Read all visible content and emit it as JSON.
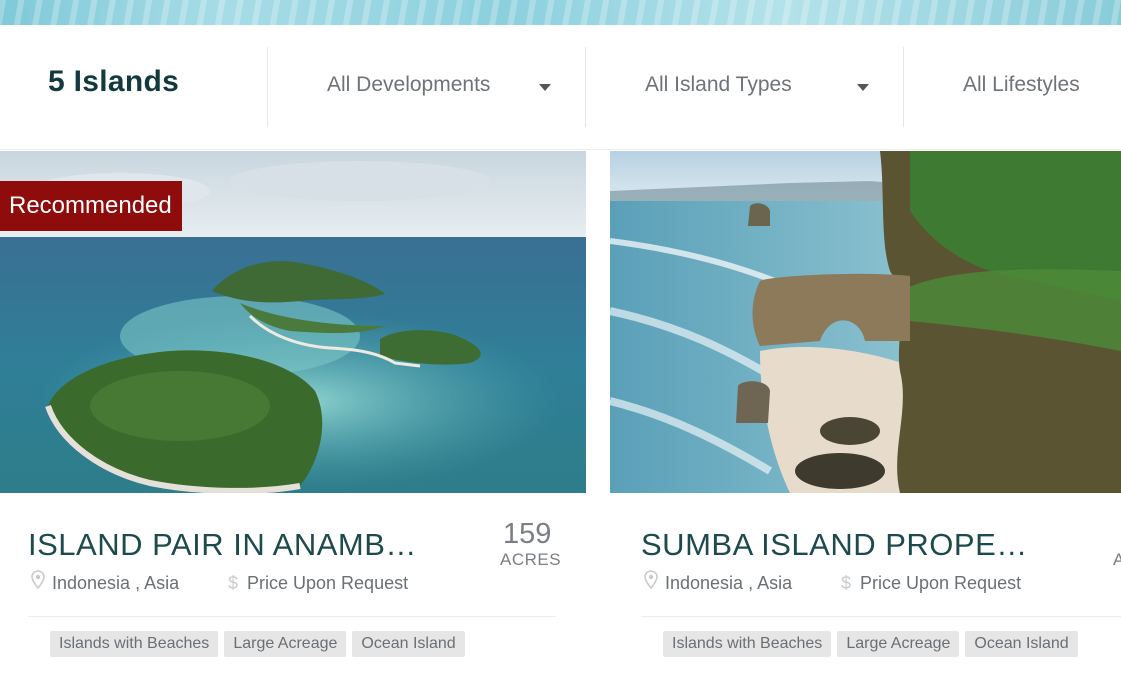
{
  "results": {
    "count_label": "5 Islands"
  },
  "filters": [
    {
      "label": "All Developments",
      "icon": "caret-down-icon"
    },
    {
      "label": "All Island Types",
      "icon": "caret-down-icon"
    },
    {
      "label": "All Lifestyles"
    }
  ],
  "listings": [
    {
      "badge": "Recommended",
      "title": "ISLAND PAIR IN ANAMB…",
      "size_value": "159",
      "size_unit": "ACRES",
      "location": "Indonesia , Asia",
      "price": "Price Upon Request",
      "tags": [
        "Islands with Beaches",
        "Large Acreage",
        "Ocean Island"
      ]
    },
    {
      "title": "SUMBA ISLAND PROPE…",
      "size_unit_partial": "A",
      "location": "Indonesia , Asia",
      "price": "Price Upon Request",
      "tags": [
        "Islands with Beaches",
        "Large Acreage",
        "Ocean Island"
      ]
    }
  ],
  "icons": {
    "location": "map-pin-icon",
    "price": "dollar-icon",
    "dropdown": "caret-down-icon"
  },
  "colors": {
    "badge": "#8f0c0c",
    "title": "#1d4a4c",
    "count": "#123a3e",
    "tag_bg": "#e6e6e6"
  }
}
